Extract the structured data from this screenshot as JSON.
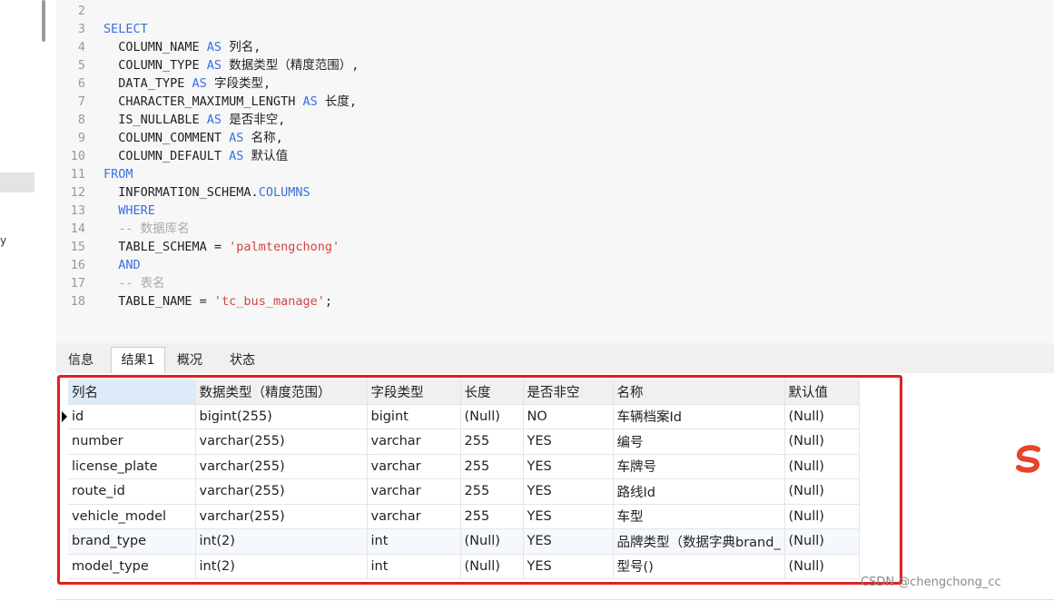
{
  "sidebar": {
    "fragment_text": "y"
  },
  "editor": {
    "lines": [
      {
        "num": "2",
        "parts": []
      },
      {
        "num": "3",
        "parts": [
          {
            "t": "SELECT",
            "c": "kw"
          }
        ]
      },
      {
        "num": "4",
        "parts": [
          {
            "t": "  COLUMN_NAME ",
            "c": "tx"
          },
          {
            "t": "AS",
            "c": "kw"
          },
          {
            "t": " 列名,",
            "c": "tx"
          }
        ]
      },
      {
        "num": "5",
        "parts": [
          {
            "t": "  COLUMN_TYPE ",
            "c": "tx"
          },
          {
            "t": "AS",
            "c": "kw"
          },
          {
            "t": " 数据类型（精度范围）,",
            "c": "tx"
          }
        ]
      },
      {
        "num": "6",
        "parts": [
          {
            "t": "  DATA_TYPE ",
            "c": "tx"
          },
          {
            "t": "AS",
            "c": "kw"
          },
          {
            "t": " 字段类型,",
            "c": "tx"
          }
        ]
      },
      {
        "num": "7",
        "parts": [
          {
            "t": "  CHARACTER_MAXIMUM_LENGTH ",
            "c": "tx"
          },
          {
            "t": "AS",
            "c": "kw"
          },
          {
            "t": " 长度,",
            "c": "tx"
          }
        ]
      },
      {
        "num": "8",
        "parts": [
          {
            "t": "  IS_NULLABLE ",
            "c": "tx"
          },
          {
            "t": "AS",
            "c": "kw"
          },
          {
            "t": " 是否非空,",
            "c": "tx"
          }
        ]
      },
      {
        "num": "9",
        "parts": [
          {
            "t": "  COLUMN_COMMENT ",
            "c": "tx"
          },
          {
            "t": "AS",
            "c": "kw"
          },
          {
            "t": " 名称,",
            "c": "tx"
          }
        ]
      },
      {
        "num": "10",
        "parts": [
          {
            "t": "  COLUMN_DEFAULT ",
            "c": "tx"
          },
          {
            "t": "AS",
            "c": "kw"
          },
          {
            "t": " 默认值",
            "c": "tx"
          }
        ]
      },
      {
        "num": "11",
        "parts": [
          {
            "t": "FROM",
            "c": "kw"
          }
        ]
      },
      {
        "num": "12",
        "parts": [
          {
            "t": "  INFORMATION_SCHEMA.",
            "c": "tx"
          },
          {
            "t": "COLUMNS",
            "c": "kw"
          }
        ]
      },
      {
        "num": "13",
        "parts": [
          {
            "t": "  WHERE",
            "c": "kw"
          }
        ]
      },
      {
        "num": "14",
        "parts": [
          {
            "t": "  -- 数据库名",
            "c": "cm"
          }
        ]
      },
      {
        "num": "15",
        "parts": [
          {
            "t": "  TABLE_SCHEMA = ",
            "c": "tx"
          },
          {
            "t": "'palmtengchong'",
            "c": "str"
          }
        ]
      },
      {
        "num": "16",
        "parts": [
          {
            "t": "  AND",
            "c": "kw"
          }
        ]
      },
      {
        "num": "17",
        "parts": [
          {
            "t": "  -- 表名",
            "c": "cm"
          }
        ]
      },
      {
        "num": "18",
        "parts": [
          {
            "t": "  TABLE_NAME = ",
            "c": "tx"
          },
          {
            "t": "'tc_bus_manage'",
            "c": "str"
          },
          {
            "t": ";",
            "c": "tx"
          }
        ]
      }
    ]
  },
  "tabs": [
    {
      "label": "信息"
    },
    {
      "label": "结果1"
    },
    {
      "label": "概况"
    },
    {
      "label": "状态"
    }
  ],
  "result": {
    "headers": [
      "列名",
      "数据类型（精度范围）",
      "字段类型",
      "长度",
      "是否非空",
      "名称",
      "默认值"
    ],
    "rows": [
      [
        "id",
        "bigint(255)",
        "bigint",
        "(Null)",
        "NO",
        "车辆档案Id",
        "(Null)"
      ],
      [
        "number",
        "varchar(255)",
        "varchar",
        "255",
        "YES",
        "编号",
        "(Null)"
      ],
      [
        "license_plate",
        "varchar(255)",
        "varchar",
        "255",
        "YES",
        "车牌号",
        "(Null)"
      ],
      [
        "route_id",
        "varchar(255)",
        "varchar",
        "255",
        "YES",
        "路线Id",
        "(Null)"
      ],
      [
        "vehicle_model",
        "varchar(255)",
        "varchar",
        "255",
        "YES",
        "车型",
        "(Null)"
      ],
      [
        "brand_type",
        "int(2)",
        "int",
        "(Null)",
        "YES",
        "品牌类型（数据字典brand_",
        "(Null)"
      ],
      [
        "model_type",
        "int(2)",
        "int",
        "(Null)",
        "YES",
        "型号()",
        "(Null)"
      ]
    ]
  },
  "watermark": "CSDN @chengchong_cc",
  "colors": {
    "keyword": "#3a6fe0",
    "string": "#d04646",
    "comment": "#aaaaaa",
    "highlight_box": "#e02020"
  }
}
